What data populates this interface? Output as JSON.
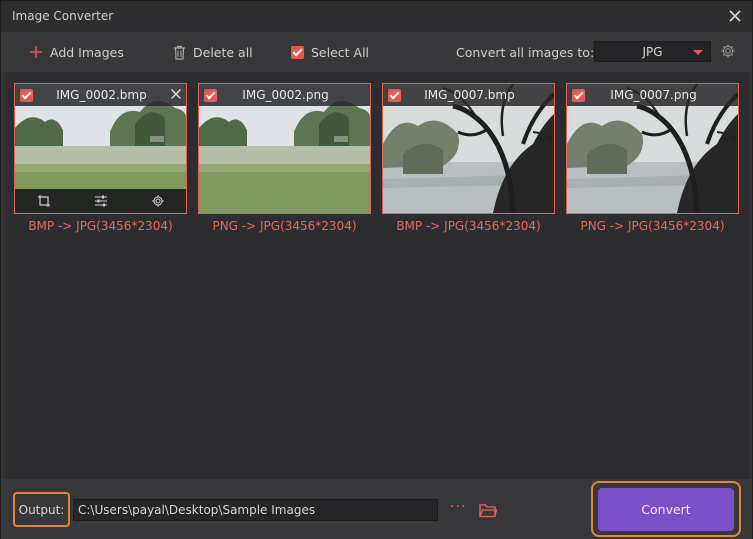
{
  "window": {
    "title": "Image Converter"
  },
  "toolbar": {
    "add_images": "Add Images",
    "delete_all": "Delete all",
    "select_all": "Select All",
    "convert_all_label": "Convert all images to:",
    "format": "JPG"
  },
  "images": [
    {
      "name": "IMG_0002.bmp",
      "caption": "BMP -> JPG(3456*2304)"
    },
    {
      "name": "IMG_0002.png",
      "caption": "PNG -> JPG(3456*2304)"
    },
    {
      "name": "IMG_0007.bmp",
      "caption": "BMP -> JPG(3456*2304)"
    },
    {
      "name": "IMG_0007.png",
      "caption": "PNG -> JPG(3456*2304)"
    }
  ],
  "output": {
    "label": "Output:",
    "path": "C:\\Users\\payal\\Desktop\\Sample Images",
    "more": "···"
  },
  "actions": {
    "convert": "Convert"
  },
  "colors": {
    "accent": "#e45a4e",
    "highlight": "#e0882f",
    "primary_button": "#7b4fc8"
  },
  "icons": [
    "plus-icon",
    "trash-icon",
    "gear-icon",
    "close-icon",
    "crop-icon",
    "adjust-icon",
    "folder-icon"
  ]
}
